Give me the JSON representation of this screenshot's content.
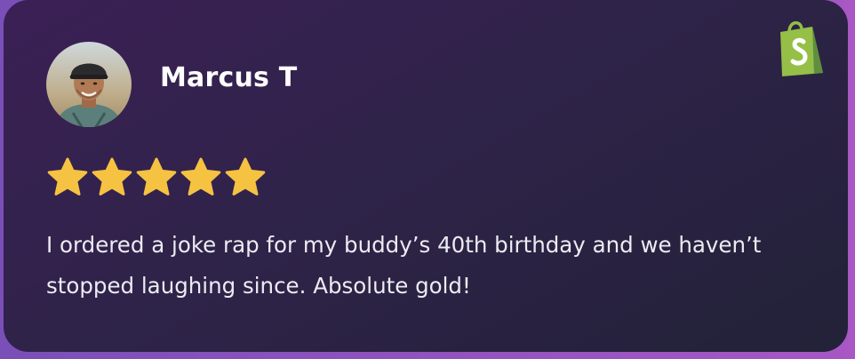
{
  "review": {
    "reviewer_name": "Marcus T",
    "rating": 5,
    "rating_max": 5,
    "text": "I ordered a joke rap for my buddy’s 40th birthday and we haven’t stopped laughing since. Absolute gold!"
  },
  "icons": {
    "platform": "shopify-bag-icon",
    "star": "star-icon",
    "avatar": "reviewer-photo"
  },
  "colors": {
    "card_bg_start": "#3b2055",
    "card_bg_end": "#222238",
    "outer_bg_start": "#7a4fb8",
    "outer_bg_end": "#a857c4",
    "star": "#f5c242",
    "shopify_green": "#95bf47",
    "text": "#ecebf2"
  }
}
